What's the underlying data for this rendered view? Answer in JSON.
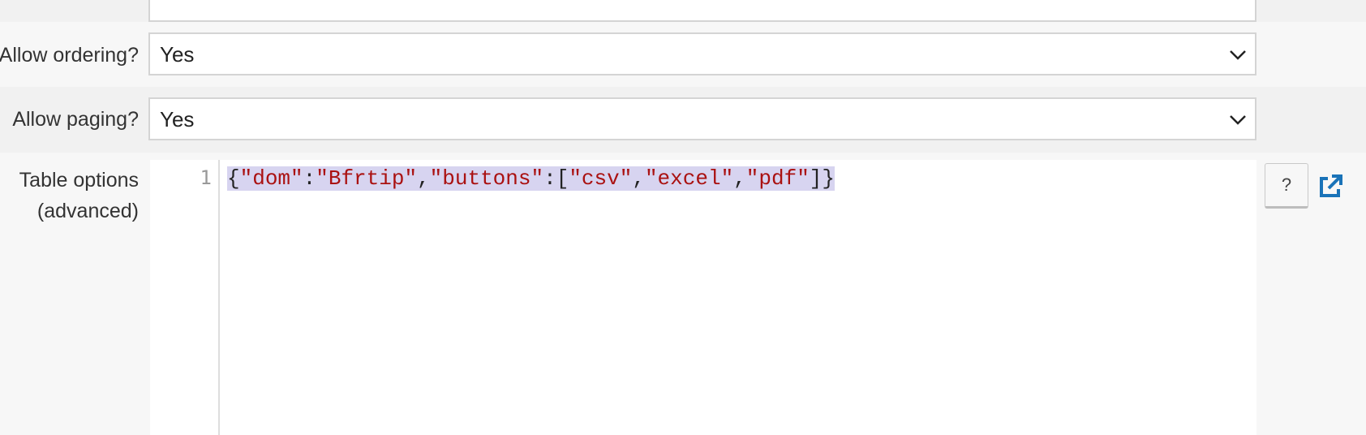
{
  "form": {
    "previous_row": {
      "label": "",
      "value": ""
    },
    "allow_ordering": {
      "label": "Allow ordering?",
      "value": "Yes"
    },
    "allow_paging": {
      "label": "Allow paging?",
      "value": "Yes"
    },
    "table_options": {
      "label_line1": "Table options",
      "label_line2": "(advanced)",
      "line_number": "1",
      "code_tokens": {
        "t1": "{",
        "t2": "\"dom\"",
        "t3": ":",
        "t4": "\"Bfrtip\"",
        "t5": ",",
        "t6": "\"buttons\"",
        "t7": ":[",
        "t8": "\"csv\"",
        "t9": ",",
        "t10": "\"excel\"",
        "t11": ",",
        "t12": "\"pdf\"",
        "t13": "]}"
      },
      "help_button_label": "?",
      "open_icon": "external-link-icon"
    }
  },
  "colors": {
    "string": "#aa1111",
    "selection": "#d7d4f0",
    "link_icon": "#1a73b8"
  }
}
